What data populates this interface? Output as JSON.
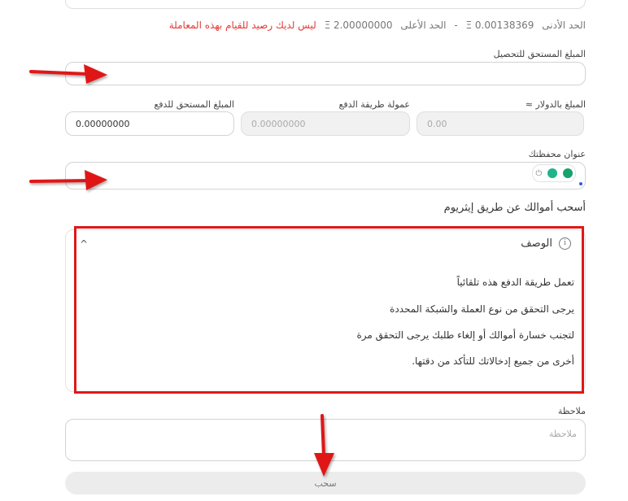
{
  "limits": {
    "min_label": "الحد الأدنى",
    "min_value": "Ξ 0.00138369",
    "separator": "-",
    "max_label": "الحد الأعلى",
    "max_value": "Ξ 2.00000000",
    "error": "ليس لديك رصيد للقيام بهذه المعاملة"
  },
  "fields": {
    "amount_due_collect_label": "المبلغ المستحق للتحصيل",
    "usd_label": "المبلغ بالدولار ≈",
    "usd_value": "0.00",
    "fee_label": "عمولة طريقة الدفع",
    "fee_value": "0.00000000",
    "amount_due_pay_label": "المبلغ المستحق للدفع",
    "amount_due_pay_value": "0.00000000",
    "wallet_label": "عنوان محفظتك"
  },
  "section_title": "أسحب أموالك عن طريق إيثريوم",
  "description": {
    "title": "الوصف",
    "lines": [
      "تعمل طريقة الدفع هذه تلقائياً",
      "يرجى التحقق من نوع العملة والشبكة المحددة",
      "لتجنب خسارة أموالك أو إلغاء طلبك يرجى التحقق مرة",
      "أخرى من جميع إدخالاتك للتأكد من دقتها."
    ]
  },
  "note": {
    "label": "ملاحظة",
    "placeholder": "ملاحظة"
  },
  "submit_label": "سحب",
  "colors": {
    "error": "#e53935",
    "annotation_red": "#e01818"
  }
}
